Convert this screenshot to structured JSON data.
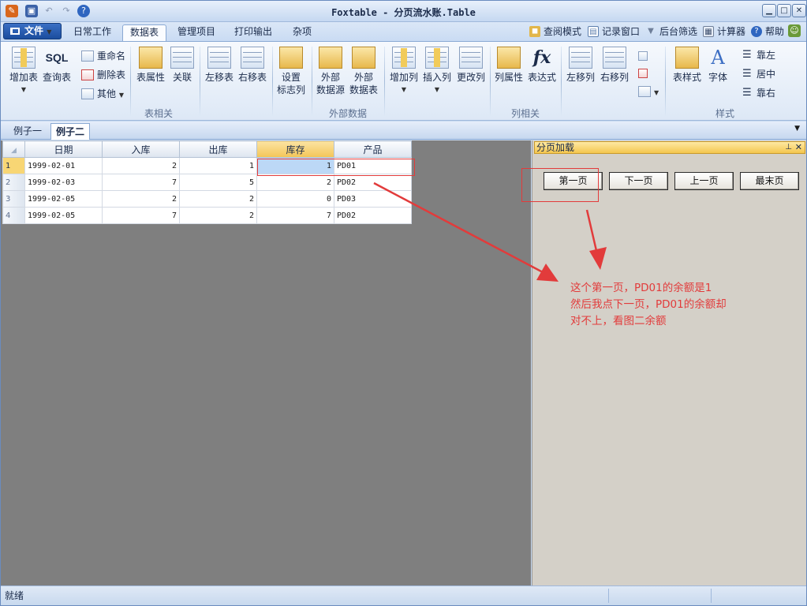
{
  "window": {
    "title": "Foxtable - 分页流水账.Table"
  },
  "menu": {
    "file_label": "文件",
    "tabs": [
      "日常工作",
      "数据表",
      "管理项目",
      "打印输出",
      "杂项"
    ],
    "active_tab": "数据表",
    "right_links": [
      "查阅模式",
      "记录窗口",
      "后台筛选",
      "计算器",
      "帮助"
    ]
  },
  "ribbon": {
    "group_table": "表相关",
    "group_external": "外部数据",
    "group_column": "列相关",
    "group_style": "样式",
    "add_table": "增加表",
    "query_table": "查询表",
    "rename": "重命名",
    "delete_table": "删除表",
    "other": "其他",
    "table_props": "表属性",
    "relation": "关联",
    "move_left": "左移表",
    "move_right": "右移表",
    "set_flag_1": "设置",
    "set_flag_2": "标志列",
    "ext_source_1": "外部",
    "ext_source_2": "数据源",
    "ext_table_1": "外部",
    "ext_table_2": "数据表",
    "add_col": "增加列",
    "insert_col": "插入列",
    "change_col": "更改列",
    "col_props": "列属性",
    "expression": "表达式",
    "col_left": "左移列",
    "col_right": "右移列",
    "table_style": "表样式",
    "font": "字体",
    "align_left": "靠左",
    "align_center": "居中",
    "align_right": "靠右",
    "sql_text": "SQL",
    "fx_text": "fx"
  },
  "doc_tabs": [
    "例子一",
    "例子二"
  ],
  "active_doc_tab": "例子二",
  "grid": {
    "columns": [
      "日期",
      "入库",
      "出库",
      "库存",
      "产品"
    ],
    "rows": [
      {
        "n": "1",
        "date": "1999-02-01",
        "in": "2",
        "out": "1",
        "stock": "1",
        "product": "PD01"
      },
      {
        "n": "2",
        "date": "1999-02-03",
        "in": "7",
        "out": "5",
        "stock": "2",
        "product": "PD02"
      },
      {
        "n": "3",
        "date": "1999-02-05",
        "in": "2",
        "out": "2",
        "stock": "0",
        "product": "PD03"
      },
      {
        "n": "4",
        "date": "1999-02-05",
        "in": "7",
        "out": "2",
        "stock": "7",
        "product": "PD02"
      }
    ]
  },
  "panel": {
    "title": "分页加载",
    "buttons": [
      "第一页",
      "下一页",
      "上一页",
      "最末页"
    ]
  },
  "annotation": {
    "text": "这个第一页，PD01的余额是1\n然后我点下一页，PD01的余额却\n对不上，看图二余额",
    "color": "#e23b3b"
  },
  "status": {
    "text": "就绪"
  }
}
